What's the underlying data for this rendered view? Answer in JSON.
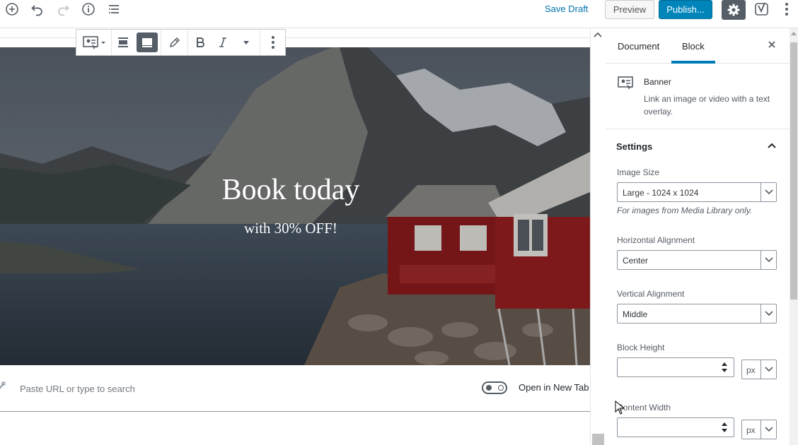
{
  "topbar": {
    "save_draft": "Save Draft",
    "preview": "Preview",
    "publish": "Publish..."
  },
  "banner": {
    "title": "Book today",
    "subtitle": "with 30% OFF!"
  },
  "link": {
    "url_placeholder": "Paste URL or type to search",
    "open_new_tab": "Open in New Tab"
  },
  "sidebar": {
    "tabs": [
      {
        "label": "Document",
        "active": false
      },
      {
        "label": "Block",
        "active": true
      }
    ],
    "block": {
      "name": "Banner",
      "description": "Link an image or video with a text overlay."
    },
    "settings": {
      "title": "Settings",
      "image_size": {
        "label": "Image Size",
        "value": "Large - 1024 x 1024",
        "help": "For images from Media Library only."
      },
      "horizontal_alignment": {
        "label": "Horizontal Alignment",
        "value": "Center"
      },
      "vertical_alignment": {
        "label": "Vertical Alignment",
        "value": "Middle"
      },
      "block_height": {
        "label": "Block Height",
        "value": "",
        "unit": "px"
      },
      "content_width": {
        "label": "Content Width",
        "value": "",
        "unit": "px"
      }
    }
  },
  "colors": {
    "accent": "#007cba",
    "publish": "#0085ba",
    "link": "#0073aa"
  },
  "icons": {
    "add": "plus-circle-icon",
    "undo": "undo-icon",
    "redo": "redo-icon",
    "info": "info-icon",
    "outline": "list-icon",
    "settings": "gear-icon",
    "yoast": "yoast-icon",
    "more": "more-vertical-icon"
  }
}
